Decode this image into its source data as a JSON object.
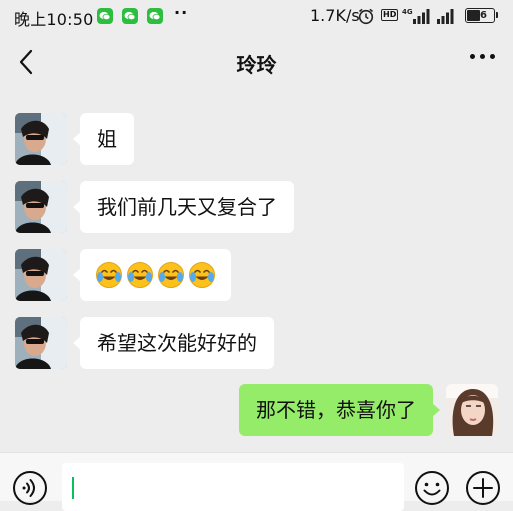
{
  "status_bar": {
    "time": "晚上10:50",
    "app_icons": [
      "wechat-icon",
      "wechat-icon",
      "wechat-icon"
    ],
    "dots": "··",
    "network_speed": "1.7K/s",
    "hd_label": "HD",
    "network_type": "4G",
    "battery_level": "46"
  },
  "header": {
    "title": "玲玲"
  },
  "messages": [
    {
      "side": "left",
      "type": "text",
      "text": "姐"
    },
    {
      "side": "left",
      "type": "text",
      "text": "我们前几天又复合了"
    },
    {
      "side": "left",
      "type": "emoji",
      "emoji": [
        "crying-laughing-emoji",
        "crying-laughing-emoji",
        "crying-laughing-emoji",
        "crying-laughing-emoji"
      ]
    },
    {
      "side": "left",
      "type": "text",
      "text": "希望这次能好好的"
    },
    {
      "side": "right",
      "type": "text",
      "text": "那不错，恭喜你了"
    }
  ],
  "input_bar": {
    "value": "",
    "icons": [
      "voice-icon",
      "emoji-icon",
      "plus-icon"
    ]
  },
  "colors": {
    "background": "#ededed",
    "self_bubble": "#95ec69",
    "other_bubble": "#ffffff",
    "accent": "#07c160"
  }
}
